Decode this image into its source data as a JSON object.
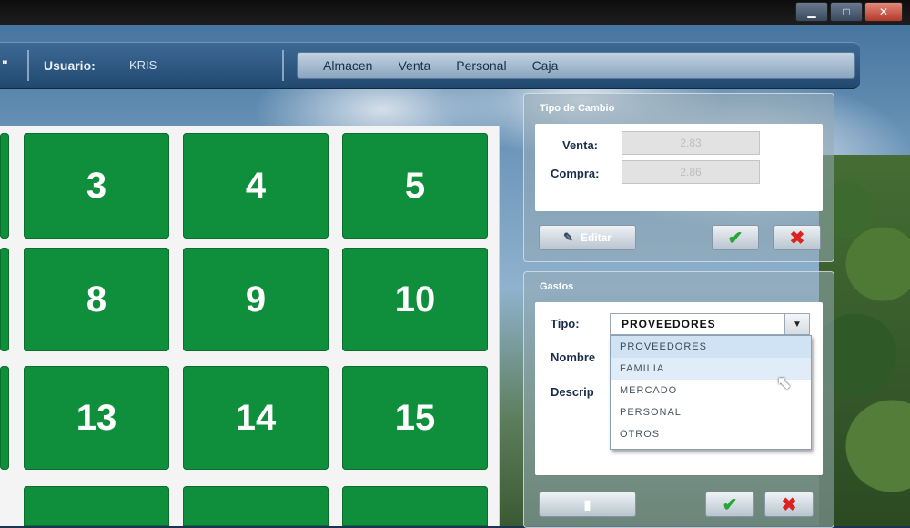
{
  "window": {
    "minimize": "▁",
    "maximize": "□",
    "close": "✕"
  },
  "header": {
    "quote": "\"",
    "user_label": "Usuario:",
    "user_value": "KRIS",
    "menu": [
      "Almacen",
      "Venta",
      "Personal",
      "Caja"
    ]
  },
  "tables": {
    "row1": [
      "3",
      "4",
      "5"
    ],
    "row2": [
      "8",
      "9",
      "10"
    ],
    "row3": [
      "13",
      "14",
      "15"
    ]
  },
  "exchange": {
    "title": "Tipo de Cambio",
    "venta_label": "Venta:",
    "venta_value": "2.83",
    "compra_label": "Compra:",
    "compra_value": "2.86",
    "edit_label": "Editar",
    "accept_icon": "check-icon",
    "cancel_icon": "x-icon"
  },
  "expense": {
    "title": "Gastos",
    "tipo_label": "Tipo:",
    "tipo_selected": "PROVEEDORES",
    "nombre_label": "Nombre",
    "descripcion_label": "Descrip",
    "options": [
      "PROVEEDORES",
      "FAMILIA",
      "MERCADO",
      "PERSONAL",
      "OTROS"
    ]
  }
}
